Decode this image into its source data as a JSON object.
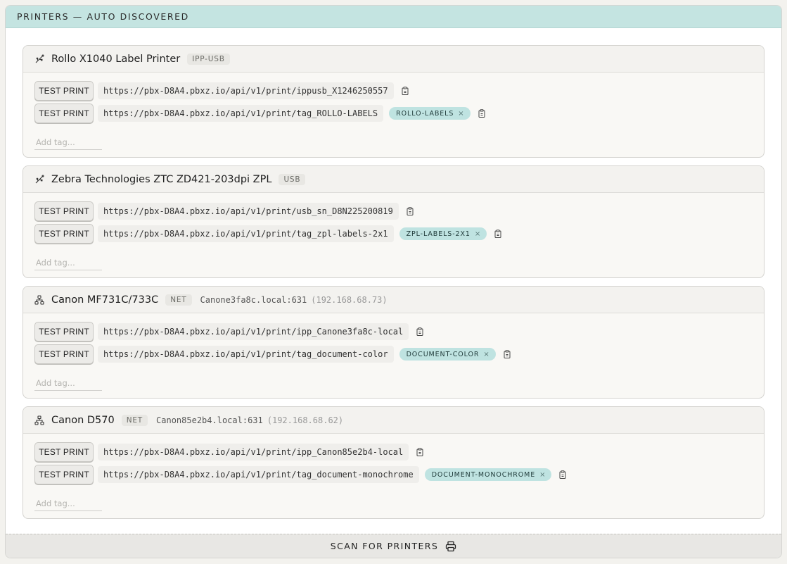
{
  "header": {
    "title": "PRINTERS — AUTO DISCOVERED"
  },
  "printers": [
    {
      "icon": "usb-icon",
      "name": "Rollo X1040 Label Printer",
      "badge": "IPP-USB",
      "host": "",
      "ip": "",
      "rows": [
        {
          "button": "TEST PRINT",
          "url": "https://pbx-D8A4.pbxz.io/api/v1/print/ippusb_X1246250557",
          "tag": ""
        },
        {
          "button": "TEST PRINT",
          "url": "https://pbx-D8A4.pbxz.io/api/v1/print/tag_ROLLO-LABELS",
          "tag": "ROLLO-LABELS"
        }
      ],
      "add_tag_placeholder": "Add tag..."
    },
    {
      "icon": "usb-icon",
      "name": "Zebra Technologies ZTC ZD421-203dpi ZPL",
      "badge": "USB",
      "host": "",
      "ip": "",
      "rows": [
        {
          "button": "TEST PRINT",
          "url": "https://pbx-D8A4.pbxz.io/api/v1/print/usb_sn_D8N225200819",
          "tag": ""
        },
        {
          "button": "TEST PRINT",
          "url": "https://pbx-D8A4.pbxz.io/api/v1/print/tag_zpl-labels-2x1",
          "tag": "ZPL-LABELS-2X1"
        }
      ],
      "add_tag_placeholder": "Add tag..."
    },
    {
      "icon": "network-icon",
      "name": "Canon MF731C/733C",
      "badge": "NET",
      "host": "Canone3fa8c.local:631",
      "ip": "(192.168.68.73)",
      "rows": [
        {
          "button": "TEST PRINT",
          "url": "https://pbx-D8A4.pbxz.io/api/v1/print/ipp_Canone3fa8c-local",
          "tag": ""
        },
        {
          "button": "TEST PRINT",
          "url": "https://pbx-D8A4.pbxz.io/api/v1/print/tag_document-color",
          "tag": "DOCUMENT-COLOR"
        }
      ],
      "add_tag_placeholder": "Add tag..."
    },
    {
      "icon": "network-icon",
      "name": "Canon D570",
      "badge": "NET",
      "host": "Canon85e2b4.local:631",
      "ip": "(192.168.68.62)",
      "rows": [
        {
          "button": "TEST PRINT",
          "url": "https://pbx-D8A4.pbxz.io/api/v1/print/ipp_Canon85e2b4-local",
          "tag": ""
        },
        {
          "button": "TEST PRINT",
          "url": "https://pbx-D8A4.pbxz.io/api/v1/print/tag_document-monochrome",
          "tag": "DOCUMENT-MONOCHROME"
        }
      ],
      "add_tag_placeholder": "Add tag..."
    }
  ],
  "tag_remove_glyph": "×",
  "scan": {
    "label": "SCAN FOR PRINTERS",
    "icon": "printer-icon"
  },
  "colors": {
    "header_bg": "#c4e4e1",
    "tag_bg": "#bfe3e1",
    "card_bg": "#f9f8f5"
  }
}
